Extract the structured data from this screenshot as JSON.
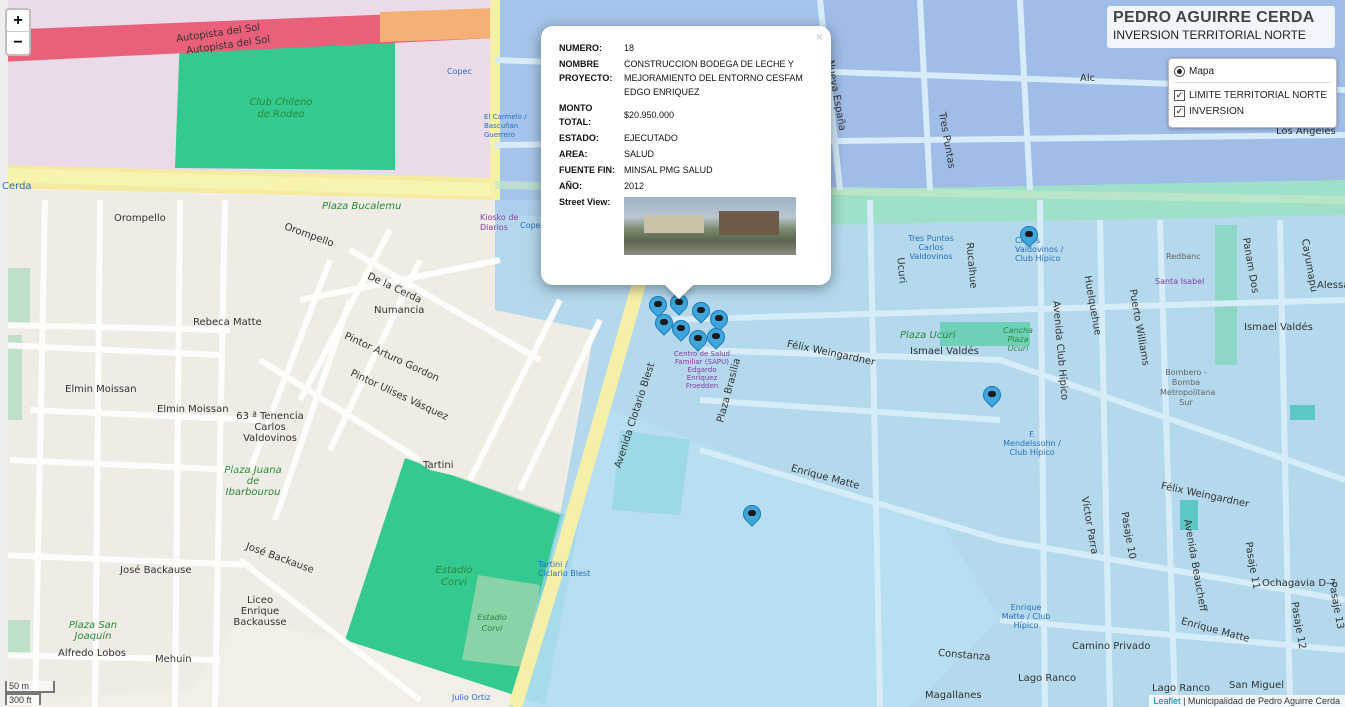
{
  "title_box": {
    "title": "PEDRO AGUIRRE CERDA",
    "subtitle": "INVERSION TERRITORIAL NORTE"
  },
  "zoom": {
    "in": "+",
    "out": "−"
  },
  "layers": {
    "base": "Mapa",
    "overlay_1": "LIMITE TERRITORIAL NORTE",
    "overlay_2": "INVERSION"
  },
  "popup": {
    "close": "×",
    "numero_label": "NUMERO:",
    "numero": "18",
    "nombre_label": "NOMBRE PROYECTO:",
    "nombre": "CONSTRUCCION BODEGA DE LECHE Y MEJORAMIENTO DEL ENTORNO CESFAM EDGO ENRIQUEZ",
    "monto_label": "MONTO TOTAL:",
    "monto": "$20.950.000",
    "estado_label": "ESTADO:",
    "estado": "EJECUTADO",
    "area_label": "AREA:",
    "area": "SALUD",
    "fuente_label": "FUENTE FIN:",
    "fuente": "MINSAL PMG SALUD",
    "anio_label": "AÑO:",
    "anio": "2012",
    "street_label": "Street View:"
  },
  "scale": {
    "metric": "50 m",
    "imperial": "300 ft"
  },
  "attribution": {
    "leaflet": "Leaflet",
    "sep": " | ",
    "source": "Municipalidad de Pedro Aguirre Cerda"
  },
  "map_labels": {
    "autopista1": "Autopista del Sol",
    "autopista2": "Autopista del Sol",
    "club": "Club Chileno de Rodeo",
    "plaza_bucalemu": "Plaza Bucalemu",
    "kiosko": "Kiosko de Diarios",
    "copec": "Copec",
    "copec2": "Copec",
    "el_carmelo": "El Carmelo / Bascuñan Guerrero",
    "orompello": "Orompello",
    "orompello2": "Orompello",
    "de_la_cerda": "De la Cerda",
    "numancia": "Numancia",
    "rebeca": "Rebeca Matte",
    "pintor_gordon": "Pintor Arturo Gordon",
    "pintor_vasquez": "Pintor Ulises Vásquez",
    "elmin": "Elmin Moissan",
    "elmin2": "Elmin Moissan",
    "tenencia": "63 ª Tenencia Carlos Valdovinos",
    "plaza_juana": "Plaza Juana de Ibarbourou",
    "estadio": "Estadio Corvi",
    "estadio2": "Estadio Corvi",
    "liceo": "Liceo Enrique Backausse",
    "jose_backause": "José Backause",
    "jose_backause2": "José Backause",
    "plaza_san_joaquin": "Plaza San Joaquín",
    "alfredo_lobos": "Alfredo Lobos",
    "mehuin": "Mehuin",
    "tartini": "Tartini",
    "tartini_bus": "Tartini / Ciclario Blest",
    "avenida_ciclario": "Avenida Clotario Blest",
    "centro_salud": "Centro de Salud Familiar (SAPU) Edgardo Enríquez Froedden",
    "plaza_brasilia": "Plaza Brasilia",
    "felix": "Félix Weingardner",
    "felix2": "Félix Weingardner",
    "enrique_matte": "Enrique Matte",
    "enrique_matte2": "Enrique Matte",
    "ismael_valdes": "Ismael Valdés",
    "ismael_valdes2": "Ismael Valdés",
    "plaza_ucuri": "Plaza Ucuri",
    "cancha": "Cancha Plaza Ucuri",
    "carlos_valdovinos": "Carlos Valdovinos / Club Hípico",
    "tres_puntas": "Tres Puntas Carlos Valdovinos",
    "santa_isabel": "Santa Isabel",
    "redbanc": "Redbanc",
    "bombero": "Bombero - Bomba Metropolitana Sur",
    "mendelssohn": "F. Mendelssohn / Club Hípico",
    "alc": "Alc",
    "los_angeles": "Los Angeles",
    "tres_puntas_st": "Tres Puntas",
    "nueva_espana": "Nueva España",
    "camino_privado": "Camino Privado",
    "constanza": "Constanza",
    "magallanes": "Magallanes",
    "lago_ranco": "Lago Ranco",
    "lago_ranco2": "Lago Ranco",
    "san_miguel": "San Miguel",
    "ochagavia": "Ochagavia D-7",
    "enrique_matte_bus": "Enrique Matte / Club Hípico",
    "victor_parra": "Víctor Parra",
    "pasaje10": "Pasaje 10",
    "pasaje11": "Pasaje 11",
    "pasaje12": "Pasaje 12",
    "pasaje13": "Pasaje 13",
    "avenida_club_hipico": "Avenida Club Hípico",
    "avenida_beaucheff": "Avenida Beaucheff",
    "cerda": "Cerda",
    "julio_ortiz": "Julio Ortiz",
    "panam_dos": "Panam Dos",
    "cayumapu": "Cayumapu",
    "puerto_williams": "Puerto Williams",
    "huelquehue": "Huelquehue",
    "rucalhue": "Rucalhue",
    "ucuri": "Ucuri",
    "alessa": "Alessa"
  }
}
